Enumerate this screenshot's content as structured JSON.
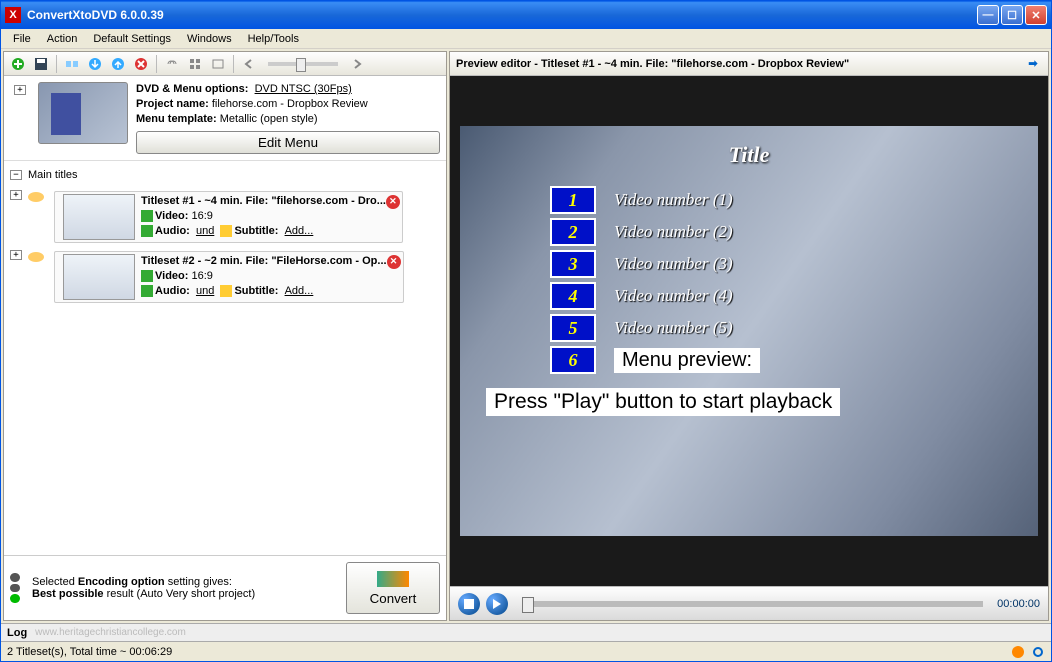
{
  "window": {
    "title": "ConvertXtoDVD 6.0.0.39"
  },
  "menubar": [
    "File",
    "Action",
    "Default Settings",
    "Windows",
    "Help/Tools"
  ],
  "dvdinfo": {
    "options_label": "DVD & Menu options:",
    "options_value": "DVD NTSC (30Fps)",
    "project_label": "Project name:",
    "project_value": "filehorse.com - Dropbox Review",
    "template_label": "Menu template:",
    "template_value": "Metallic (open style)",
    "edit_button": "Edit Menu"
  },
  "tree": {
    "main_label": "Main titles",
    "titlesets": [
      {
        "title": "Titleset #1 - ~4 min. File: \"filehorse.com - Dro...",
        "video_label": "Video:",
        "video": "16:9",
        "audio_label": "Audio:",
        "audio": "und",
        "subtitle_label": "Subtitle:",
        "subtitle": "Add..."
      },
      {
        "title": "Titleset #2 - ~2 min. File: \"FileHorse.com - Op...",
        "video_label": "Video:",
        "video": "16:9",
        "audio_label": "Audio:",
        "audio": "und",
        "subtitle_label": "Subtitle:",
        "subtitle": "Add..."
      }
    ]
  },
  "encoding": {
    "line1a": "Selected ",
    "line1b": "Encoding option",
    "line1c": " setting gives:",
    "line2a": "Best possible",
    "line2b": " result (Auto Very short project)"
  },
  "convert_label": "Convert",
  "preview": {
    "header": "Preview editor - Titleset #1 - ~4 min. File: \"filehorse.com - Dropbox Review\"",
    "title": "Title",
    "items": [
      {
        "num": "1",
        "label": "Video number (1)"
      },
      {
        "num": "2",
        "label": "Video number (2)"
      },
      {
        "num": "3",
        "label": "Video number (3)"
      },
      {
        "num": "4",
        "label": "Video number (4)"
      },
      {
        "num": "5",
        "label": "Video number (5)"
      },
      {
        "num": "6",
        "label": "Menu preview:"
      }
    ],
    "playmsg": "Press \"Play\" button to start playback"
  },
  "player": {
    "time": "00:00:00"
  },
  "log_label": "Log",
  "watermark": "www.heritagechristiancollege.com",
  "status": "2 Titleset(s), Total time ~ 00:06:29"
}
